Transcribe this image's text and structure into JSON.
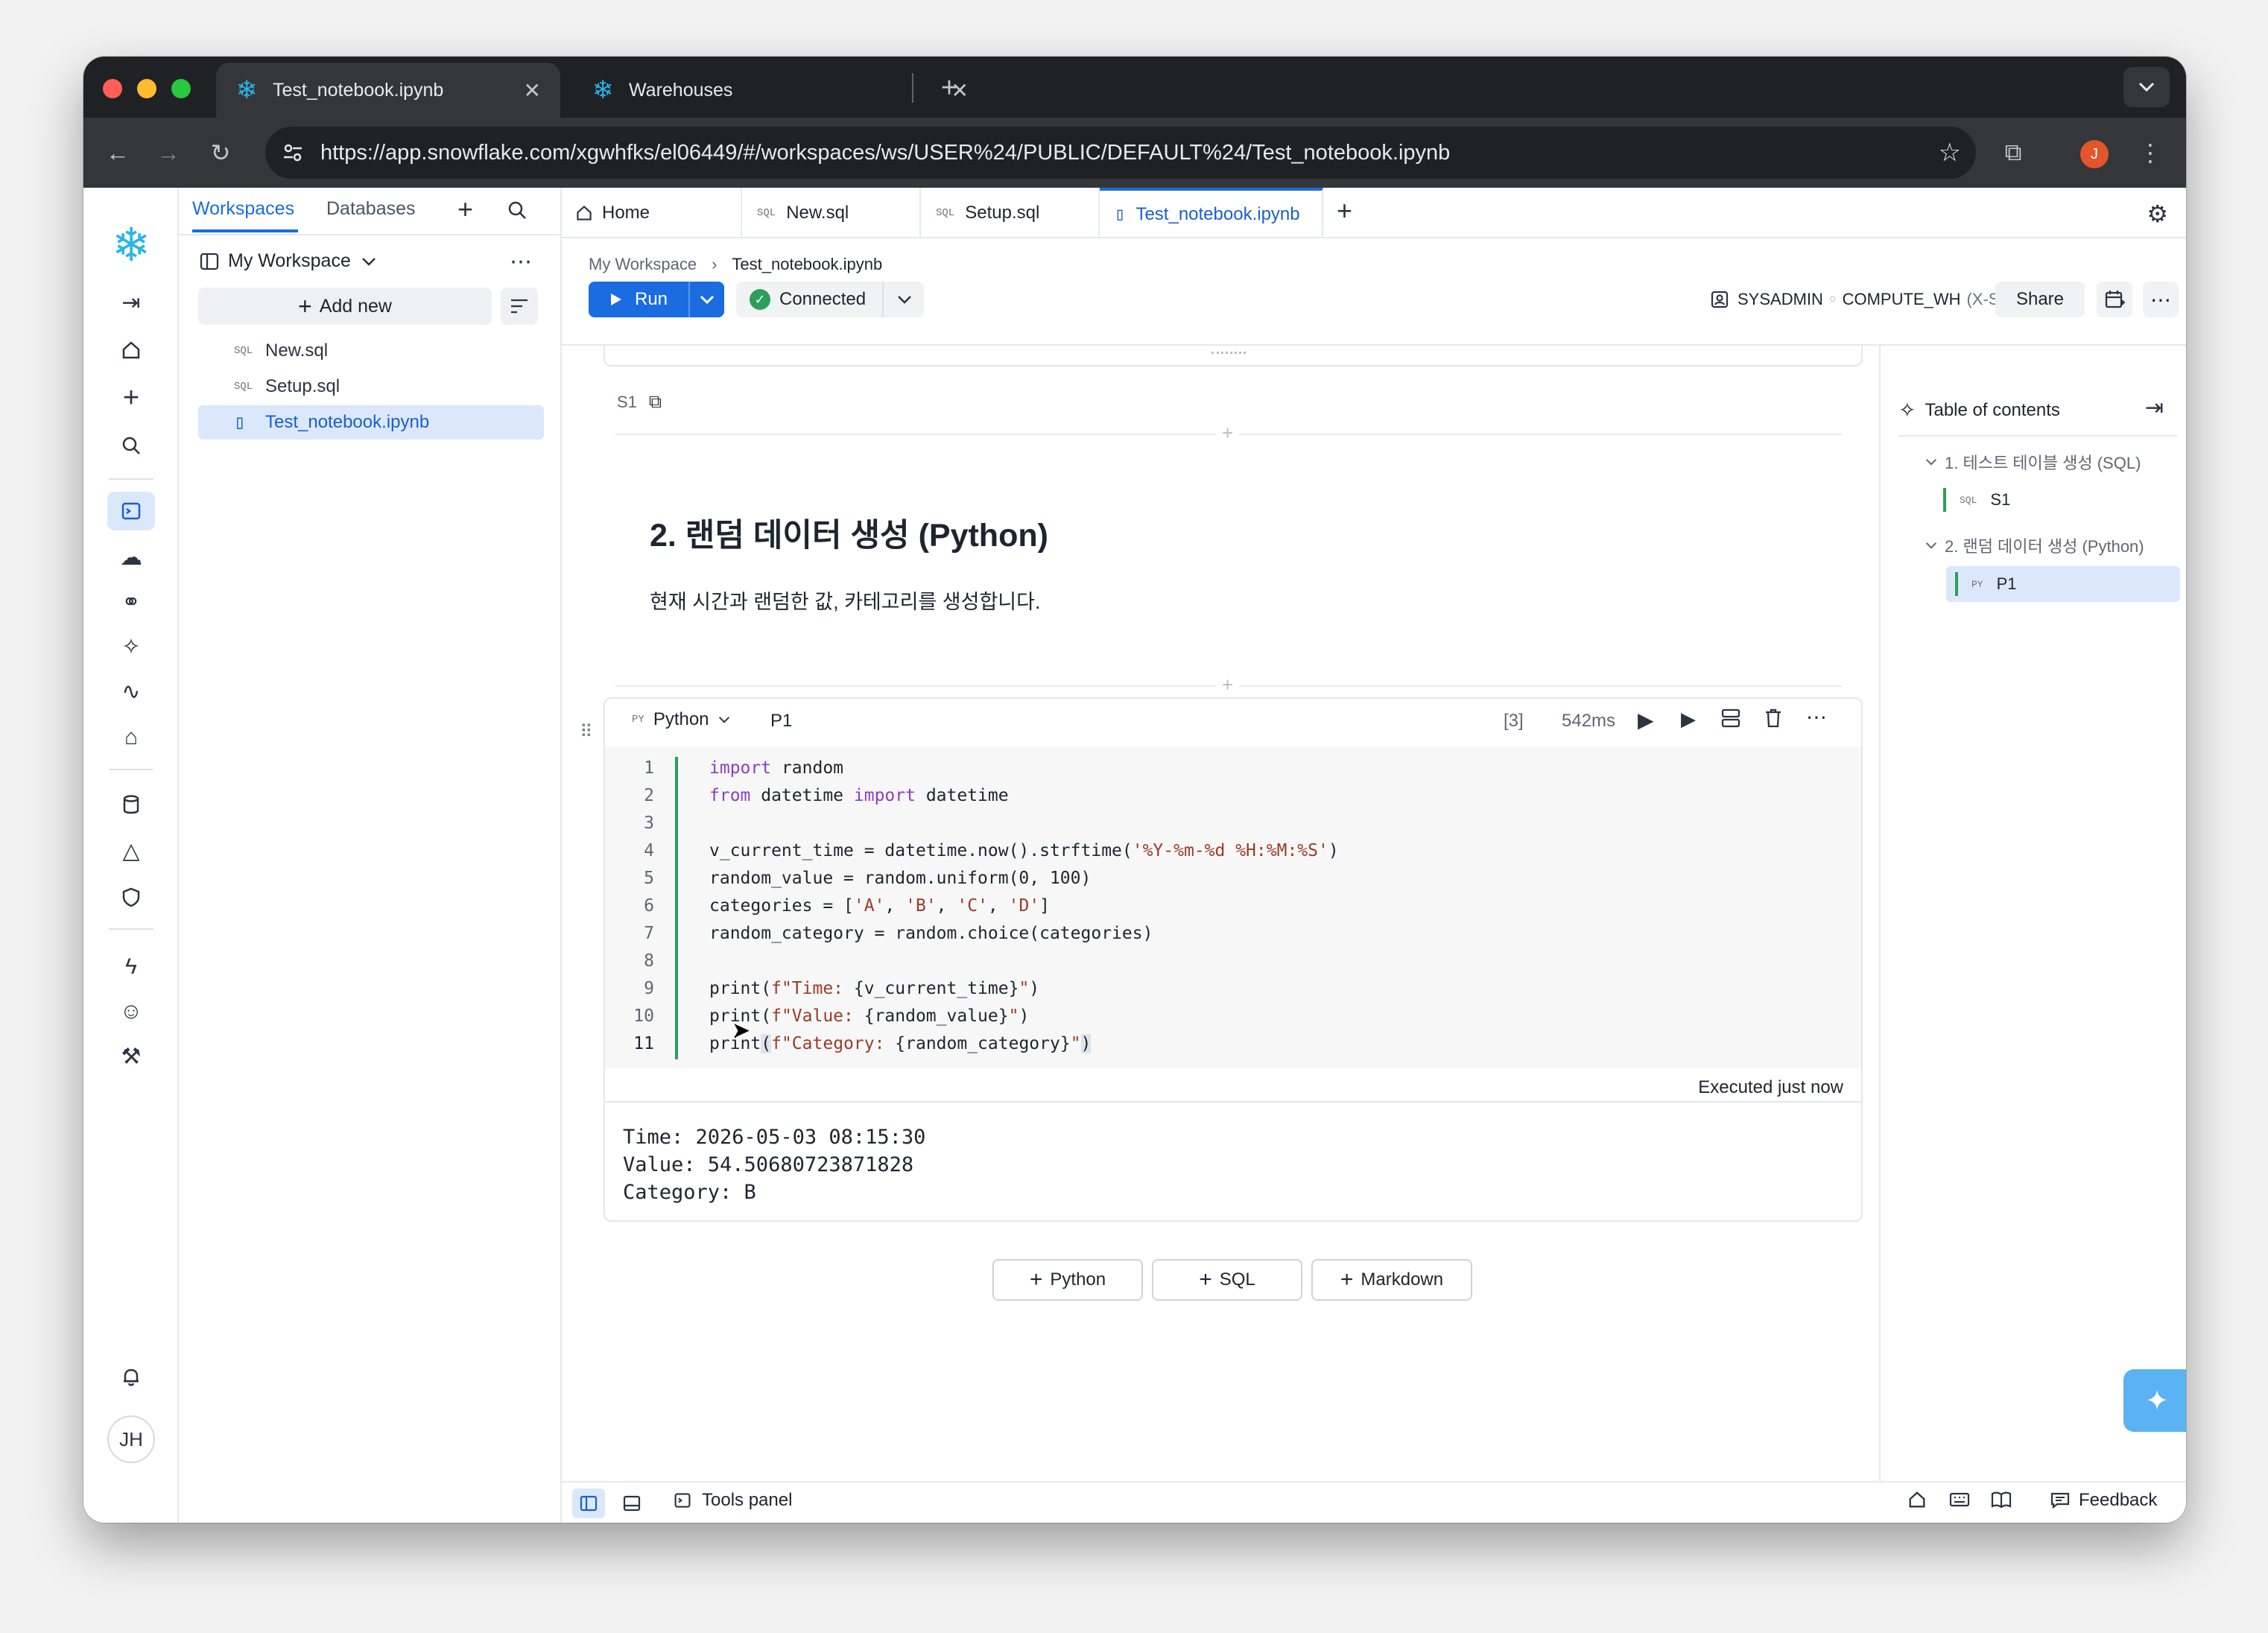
{
  "browser": {
    "tabs": [
      {
        "title": "Test_notebook.ipynb",
        "active": true
      },
      {
        "title": "Warehouses",
        "active": false
      }
    ],
    "new_tab": "+",
    "url": "https://app.snowflake.com/xgwhfks/el06449/#/workspaces/ws/USER%24/PUBLIC/DEFAULT%24/Test_notebook.ipynb",
    "profile_initial": "J"
  },
  "rail": {
    "user_initials": "JH"
  },
  "sidebar": {
    "tabs": [
      "Workspaces",
      "Databases"
    ],
    "workspace_name": "My Workspace",
    "add_new_label": "Add new",
    "files": [
      {
        "name": "New.sql",
        "icon": "sql-file-icon"
      },
      {
        "name": "Setup.sql",
        "icon": "sql-file-icon"
      },
      {
        "name": "Test_notebook.ipynb",
        "icon": "notebook-file-icon",
        "active": true
      }
    ]
  },
  "editor_tabs": [
    {
      "label": "Home",
      "icon": "home-icon"
    },
    {
      "label": "New.sql",
      "icon": "sql-file-icon"
    },
    {
      "label": "Setup.sql",
      "icon": "sql-file-icon"
    },
    {
      "label": "Test_notebook.ipynb",
      "icon": "notebook-file-icon",
      "active": true
    }
  ],
  "toolbar": {
    "breadcrumb": [
      "My Workspace",
      "Test_notebook.ipynb"
    ],
    "run_label": "Run",
    "status_label": "Connected",
    "role": "SYSADMIN",
    "warehouse": "COMPUTE_WH",
    "warehouse_size": "(X-Small)",
    "share_label": "Share"
  },
  "notebook": {
    "prev_cell_name": "S1",
    "markdown": {
      "heading": "2. 랜덤 데이터 생성 (Python)",
      "body": "현재 시간과 랜덤한 값, 카테고리를 생성합니다."
    },
    "python_cell": {
      "language": "Python",
      "name": "P1",
      "exec_count": "[3]",
      "duration": "542ms",
      "line_numbers": [
        "1",
        "2",
        "3",
        "4",
        "5",
        "6",
        "7",
        "8",
        "9",
        "10",
        "11"
      ],
      "executed_label": "Executed just now",
      "output": [
        "Time: 2026-05-03 08:15:30",
        "Value: 54.50680723871828",
        "Category: B"
      ]
    },
    "add_cell_buttons": [
      "Python",
      "SQL",
      "Markdown"
    ]
  },
  "toc": {
    "title": "Table of contents",
    "items": [
      {
        "label": "1. 테스트 테이블 생성 (SQL)",
        "children": [
          {
            "label": "S1",
            "icon": "sql-file-icon"
          }
        ]
      },
      {
        "label": "2. 랜덤 데이터 생성 (Python)",
        "children": [
          {
            "label": "P1",
            "icon": "python-file-icon",
            "active": true
          }
        ]
      }
    ]
  },
  "footer": {
    "tools_panel_label": "Tools panel",
    "feedback_label": "Feedback"
  },
  "colors": {
    "accent": "#1a6ce0",
    "connected": "#2e9e5b",
    "browser_dark": "#202124"
  }
}
